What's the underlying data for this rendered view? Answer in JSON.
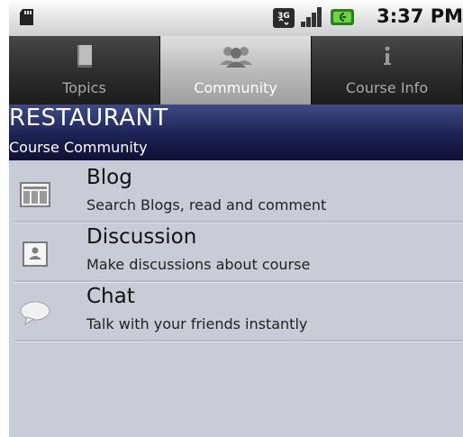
{
  "status_bar": {
    "time": "3:37 PM",
    "icons": [
      "sd-card-icon",
      "3g-icon",
      "signal-icon",
      "battery-icon"
    ]
  },
  "tabs": [
    {
      "label": "Topics",
      "icon": "book-icon",
      "active": false
    },
    {
      "label": "Community",
      "icon": "people-icon",
      "active": true
    },
    {
      "label": "Course Info",
      "icon": "info-icon",
      "active": false
    }
  ],
  "header": {
    "title": "RESTAURANT",
    "subtitle": "Course Community"
  },
  "items": [
    {
      "title": "Blog",
      "subtitle": "Search Blogs, read and comment",
      "icon": "blog-icon"
    },
    {
      "title": "Discussion",
      "subtitle": "Make discussions about course",
      "icon": "discussion-icon"
    },
    {
      "title": "Chat",
      "subtitle": "Talk with your friends instantly",
      "icon": "chat-icon"
    }
  ],
  "colors": {
    "header_top": "#3f4a86",
    "header_bottom": "#0e1034",
    "list_bg": "#c8ccd6",
    "tab_active": "#b8b8b8",
    "tab_inactive": "#2a2a2a"
  }
}
